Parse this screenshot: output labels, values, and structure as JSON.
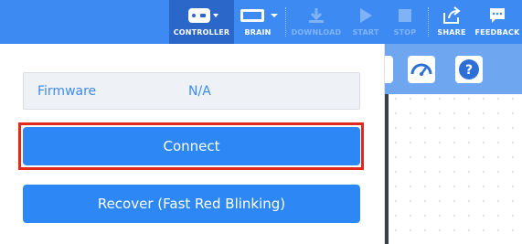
{
  "toolbar": {
    "controller_label": "CONTROLLER",
    "brain_label": "BRAIN",
    "download_label": "DOWNLOAD",
    "start_label": "START",
    "stop_label": "STOP",
    "share_label": "SHARE",
    "feedback_label": "FEEDBACK"
  },
  "panel": {
    "firmware_label": "Firmware",
    "firmware_value": "N/A",
    "connect_label": "Connect",
    "recover_label": "Recover (Fast Red Blinking)"
  },
  "colors": {
    "toolbar": "#3d8bf2",
    "active_tool": "#2a67c9",
    "button": "#2d88f5",
    "highlight": "#e3281d"
  },
  "icons": [
    "controller-icon",
    "brain-icon",
    "download-icon",
    "play-icon",
    "stop-icon",
    "share-icon",
    "feedback-icon",
    "gauge-icon",
    "help-icon"
  ]
}
